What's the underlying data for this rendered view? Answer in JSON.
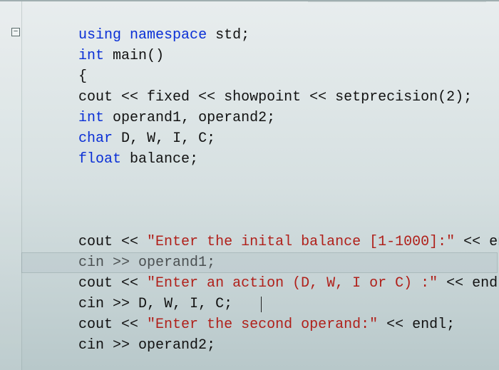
{
  "editor": {
    "fold_glyph": "−",
    "highlighted_line_index": 12
  },
  "code": {
    "l0": {
      "t0": "using",
      "t1": " ",
      "t2": "namespace",
      "t3": " ",
      "t4": "std",
      "t5": ";"
    },
    "l1": {
      "t0": "int",
      "t1": " ",
      "t2": "main",
      "t3": "()"
    },
    "l2": {
      "t0": "{"
    },
    "l3": {
      "t0": "cout",
      "t1": " << ",
      "t2": "fixed",
      "t3": " << ",
      "t4": "showpoint",
      "t5": " << ",
      "t6": "setprecision",
      "t7": "(",
      "t8": "2",
      "t9": ");"
    },
    "l4": {
      "t0": "int",
      "t1": " ",
      "t2": "operand1",
      "t3": ", ",
      "t4": "operand2",
      "t5": ";"
    },
    "l5": {
      "t0": "char",
      "t1": " ",
      "t2": "D",
      "t3": ", ",
      "t4": "W",
      "t5": ", ",
      "t6": "I",
      "t7": ", ",
      "t8": "C",
      "t9": ";"
    },
    "l6": {
      "t0": "float",
      "t1": " ",
      "t2": "balance",
      "t3": ";"
    },
    "l10": {
      "t0": "cout",
      "t1": " << ",
      "t2": "\"Enter the inital balance [1-1000]:\"",
      "t3": " << ",
      "t4": "endl",
      "t5": ";"
    },
    "l11": {
      "t0": "cin",
      "t1": " >> ",
      "t2": "operand1",
      "t3": ";"
    },
    "l12": {
      "t0": "cout",
      "t1": " << ",
      "t2": "\"Enter an action (D, W, I or C) :\"",
      "t3": " << ",
      "t4": "endl",
      "t5": ";"
    },
    "l13": {
      "t0": "cin",
      "t1": " >> ",
      "t2": "D",
      "t3": ", ",
      "t4": "W",
      "t5": ", ",
      "t6": "I",
      "t7": ", ",
      "t8": "C",
      "t9": ";"
    },
    "l14": {
      "t0": "cout",
      "t1": " << ",
      "t2": "\"Enter the second op",
      "t2b": "e",
      "t2c": "rand:\"",
      "t3": " << ",
      "t4": "endl",
      "t5": ";"
    },
    "l15": {
      "t0": "cin",
      "t1": " >> ",
      "t2": "operand2",
      "t3": ";"
    }
  }
}
